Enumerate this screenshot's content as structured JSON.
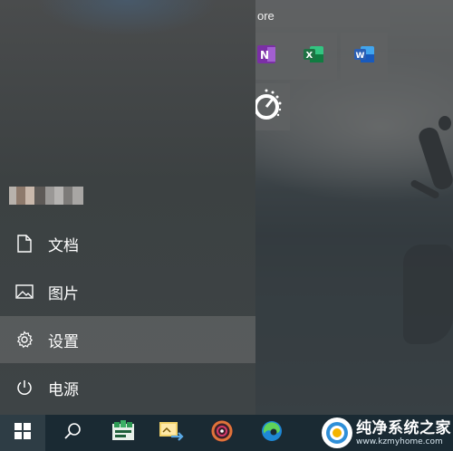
{
  "start_menu": {
    "user_name_blurred": "",
    "items": [
      {
        "label": "文档",
        "icon": "document-icon"
      },
      {
        "label": "图片",
        "icon": "pictures-icon"
      },
      {
        "label": "设置",
        "icon": "gear-icon",
        "hovered": true
      },
      {
        "label": "电源",
        "icon": "power-icon"
      }
    ]
  },
  "tiles": {
    "wide_tile_label": "ore",
    "apps": [
      "onenote-icon",
      "excel-icon",
      "word-icon",
      "groove-music-icon"
    ]
  },
  "taskbar": {
    "items": [
      "start-icon",
      "search-icon",
      "space-app-icon",
      "photos-app-icon",
      "media-app-icon",
      "edge-icon"
    ]
  },
  "watermark": {
    "title": "纯净系统之家",
    "url": "www.kzmyhome.com"
  },
  "colors": {
    "taskbar": "#1a2a33",
    "excel": "#1f7244",
    "word": "#2b5fb4",
    "onenote": "#7b2fa6"
  }
}
